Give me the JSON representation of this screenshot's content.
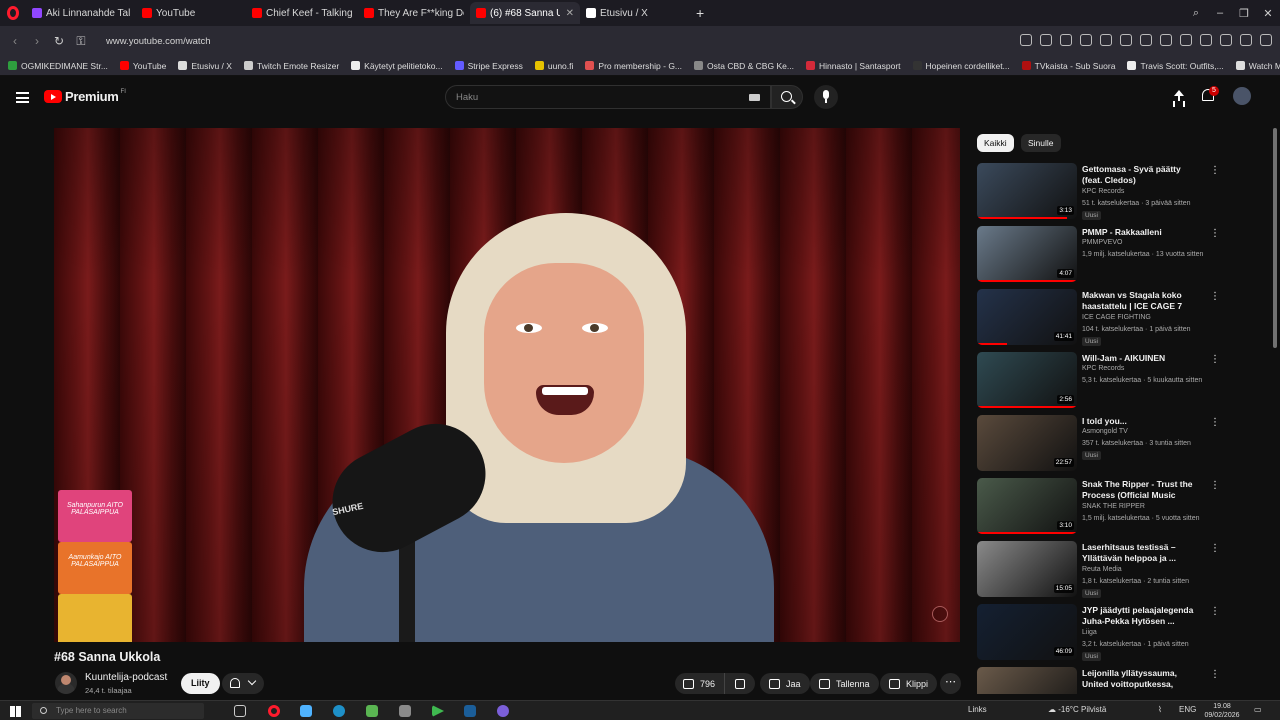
{
  "browser": {
    "tabs": [
      {
        "label": "Aki Linnanahde Talk Show",
        "color": "#9147ff",
        "active": false
      },
      {
        "label": "YouTube",
        "color": "#ff0000",
        "active": false
      },
      {
        "label": "Chief Keef - Talking It",
        "color": "#ff0000",
        "active": false
      },
      {
        "label": "They Are F**king Desperat",
        "color": "#ff0000",
        "active": false
      },
      {
        "label": "(6) #68 Sanna Ukkola",
        "color": "#ff0000",
        "active": true
      },
      {
        "label": "Etusivu / X",
        "color": "#ffffff",
        "active": false
      }
    ],
    "url": "www.youtube.com/watch",
    "bookmarks": [
      {
        "label": "OGMIKEDIMANE Str...",
        "color": "#2e9e3e"
      },
      {
        "label": "YouTube",
        "color": "#ff0000"
      },
      {
        "label": "Etusivu / X",
        "color": "#dddddd"
      },
      {
        "label": "Twitch Emote Resizer",
        "color": "#cccccc"
      },
      {
        "label": "Käytetyt pelitietoko...",
        "color": "#eeeeee"
      },
      {
        "label": "Stripe Express",
        "color": "#635bff"
      },
      {
        "label": "uuno.fi",
        "color": "#e6c200"
      },
      {
        "label": "Pro membership - G...",
        "color": "#e05050"
      },
      {
        "label": "Osta CBD & CBG Ke...",
        "color": "#888888"
      },
      {
        "label": "Hinnasto | Santasport",
        "color": "#d42a3a"
      },
      {
        "label": "Hopeinen cordelliket...",
        "color": "#333333"
      },
      {
        "label": "TVkaista - Sub Suora",
        "color": "#b01010"
      },
      {
        "label": "Travis Scott: Outfits,...",
        "color": "#eeeeee"
      },
      {
        "label": "Watch Marvel's Luk...",
        "color": "#dddddd"
      }
    ]
  },
  "header": {
    "logo_text": "Premium",
    "logo_region": "FI",
    "search_placeholder": "Haku",
    "notification_count": "5"
  },
  "video": {
    "title": "#68 Sanna Ukkola",
    "channel": "Kuuntelija-podcast",
    "subscribers": "24,4 t. tilaajaa",
    "join_label": "Liity",
    "likes": "796",
    "share_label": "Jaa",
    "save_label": "Tallenna",
    "clip_label": "Klippi",
    "mic_brand": "SHURE",
    "box_labels": [
      "Sahanpurun AITO PALASAIPPUA",
      "Aamunkajo AITO PALASAIPPUA",
      ""
    ]
  },
  "sidebar": {
    "chips": [
      "Kaikki",
      "Sinulle"
    ],
    "recommendations": [
      {
        "title": "Gettomasa - Syvä päätty (feat. Cledos)",
        "channel": "KPC Records",
        "meta": "51 t. katselukertaa · 3 päivää sitten",
        "badge": "Uusi",
        "duration": "3:13",
        "progress": 0.9,
        "thumb": "#3b4a5c"
      },
      {
        "title": "PMMP - Rakkaalleni",
        "channel": "PMMPVEVO",
        "meta": "1,9 milj. katselukertaa · 13 vuotta sitten",
        "badge": "",
        "duration": "4:07",
        "progress": 1.0,
        "thumb": "#6a7a8a"
      },
      {
        "title": "Makwan vs Stagala koko haastattelu | ICE CAGE 7",
        "channel": "ICE CAGE FIGHTING",
        "meta": "104 t. katselukertaa · 1 päivä sitten",
        "badge": "Uusi",
        "duration": "41:41",
        "progress": 0.3,
        "thumb": "#24324a"
      },
      {
        "title": "Will-Jam - AIKUINEN",
        "channel": "KPC Records",
        "meta": "5,3 t. katselukertaa · 5 kuukautta sitten",
        "badge": "",
        "duration": "2:56",
        "progress": 1.0,
        "thumb": "#2f4a52"
      },
      {
        "title": "I told you...",
        "channel": "Asmongold TV",
        "meta": "357 t. katselukertaa · 3 tuntia sitten",
        "badge": "Uusi",
        "duration": "22:57",
        "progress": 0,
        "thumb": "#5a4a3c"
      },
      {
        "title": "Snak The Ripper - Trust the Process (Official Music Video)",
        "channel": "SNAK THE RIPPER",
        "meta": "1,5 milj. katselukertaa · 5 vuotta sitten",
        "badge": "",
        "duration": "3:10",
        "progress": 1.0,
        "thumb": "#4a5a4a"
      },
      {
        "title": "Laserhitsaus testissä – Yllättävän helppoa ja ...",
        "channel": "Reuta Media",
        "meta": "1,8 t. katselukertaa · 2 tuntia sitten",
        "badge": "Uusi",
        "duration": "15:05",
        "progress": 0,
        "thumb": "#8a8a8a"
      },
      {
        "title": "JYP jäädytti pelaajalegenda Juha-Pekka Hytösen ...",
        "channel": "Liiga",
        "meta": "3,2 t. katselukertaa · 1 päivä sitten",
        "badge": "Uusi",
        "duration": "46:09",
        "progress": 0,
        "thumb": "#142032"
      },
      {
        "title": "Leijonilla yllätyssauma, United voittoputkessa, vieraana Lass...",
        "channel": "",
        "meta": "",
        "badge": "",
        "duration": "",
        "progress": 0,
        "thumb": "#6a5a4a"
      }
    ]
  },
  "taskbar": {
    "search_placeholder": "Type here to search",
    "links_label": "Links",
    "weather": "-16°C Pilvistä",
    "language": "ENG",
    "time": "19.08",
    "date": "09/02/2026"
  }
}
